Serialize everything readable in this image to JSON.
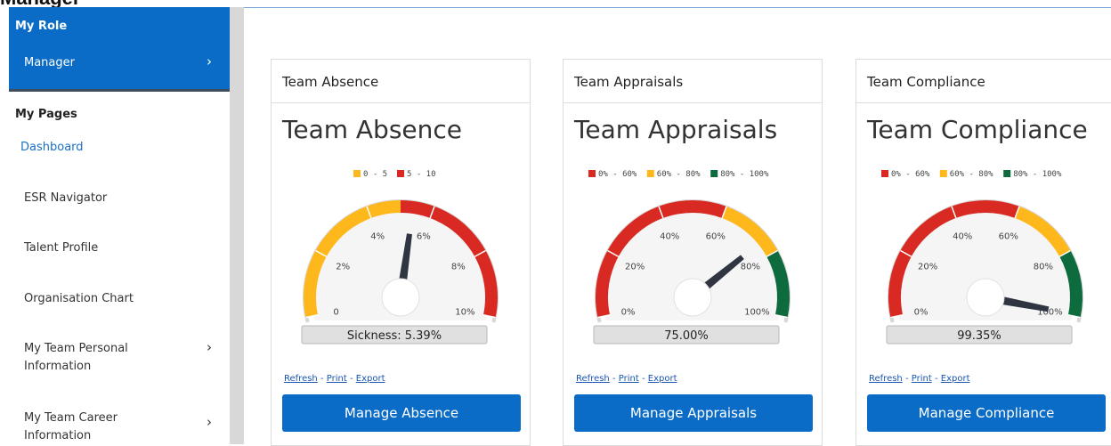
{
  "page": {
    "title": "Manager"
  },
  "sidebar": {
    "role_title": "My Role",
    "role_item": "Manager",
    "pages_title": "My Pages",
    "items": [
      {
        "label": "Dashboard"
      },
      {
        "label": "ESR Navigator"
      },
      {
        "label": "Talent Profile"
      },
      {
        "label": "Organisation Chart"
      },
      {
        "label": "My Team Personal Information"
      },
      {
        "label": "My Team Career Information"
      }
    ]
  },
  "links": {
    "refresh": "Refresh",
    "print": "Print",
    "export": "Export",
    "sep": "-"
  },
  "colors": {
    "accent": "#0a6cc7",
    "red": "#d82a22",
    "amber": "#ffb81c",
    "green": "#0e6b3d"
  },
  "cards": [
    {
      "header": "Team Absence",
      "big_title": "Team Absence",
      "button": "Manage Absence",
      "gauge": {
        "min": 0,
        "max": 10,
        "value": 5.39,
        "readout": "Sickness: 5.39%",
        "ticks": [
          "0",
          "2%",
          "4%",
          "6%",
          "8%",
          "10%"
        ],
        "legend": [
          {
            "label": "0 - 5",
            "color": "#ffb81c"
          },
          {
            "label": "5 - 10",
            "color": "#d82a22"
          }
        ],
        "bands": [
          {
            "from": 0,
            "to": 5,
            "color": "#ffb81c"
          },
          {
            "from": 5,
            "to": 10,
            "color": "#d82a22"
          }
        ]
      }
    },
    {
      "header": "Team Appraisals",
      "big_title": "Team Appraisals",
      "button": "Manage Appraisals",
      "gauge": {
        "min": 0,
        "max": 100,
        "value": 75,
        "readout": "75.00%",
        "ticks": [
          "0%",
          "20%",
          "40%",
          "60%",
          "80%",
          "100%"
        ],
        "legend": [
          {
            "label": "0% - 60%",
            "color": "#d82a22"
          },
          {
            "label": "60% - 80%",
            "color": "#ffb81c"
          },
          {
            "label": "80% - 100%",
            "color": "#0e6b3d"
          }
        ],
        "bands": [
          {
            "from": 0,
            "to": 60,
            "color": "#d82a22"
          },
          {
            "from": 60,
            "to": 80,
            "color": "#ffb81c"
          },
          {
            "from": 80,
            "to": 100,
            "color": "#0e6b3d"
          }
        ]
      }
    },
    {
      "header": "Team Compliance",
      "big_title": "Team Compliance",
      "button": "Manage Compliance",
      "gauge": {
        "min": 0,
        "max": 100,
        "value": 99.35,
        "readout": "99.35%",
        "ticks": [
          "0%",
          "20%",
          "40%",
          "60%",
          "80%",
          "100%"
        ],
        "legend": [
          {
            "label": "0% - 60%",
            "color": "#d82a22"
          },
          {
            "label": "60% - 80%",
            "color": "#ffb81c"
          },
          {
            "label": "80% - 100%",
            "color": "#0e6b3d"
          }
        ],
        "bands": [
          {
            "from": 0,
            "to": 60,
            "color": "#d82a22"
          },
          {
            "from": 60,
            "to": 80,
            "color": "#ffb81c"
          },
          {
            "from": 80,
            "to": 100,
            "color": "#0e6b3d"
          }
        ]
      }
    }
  ]
}
